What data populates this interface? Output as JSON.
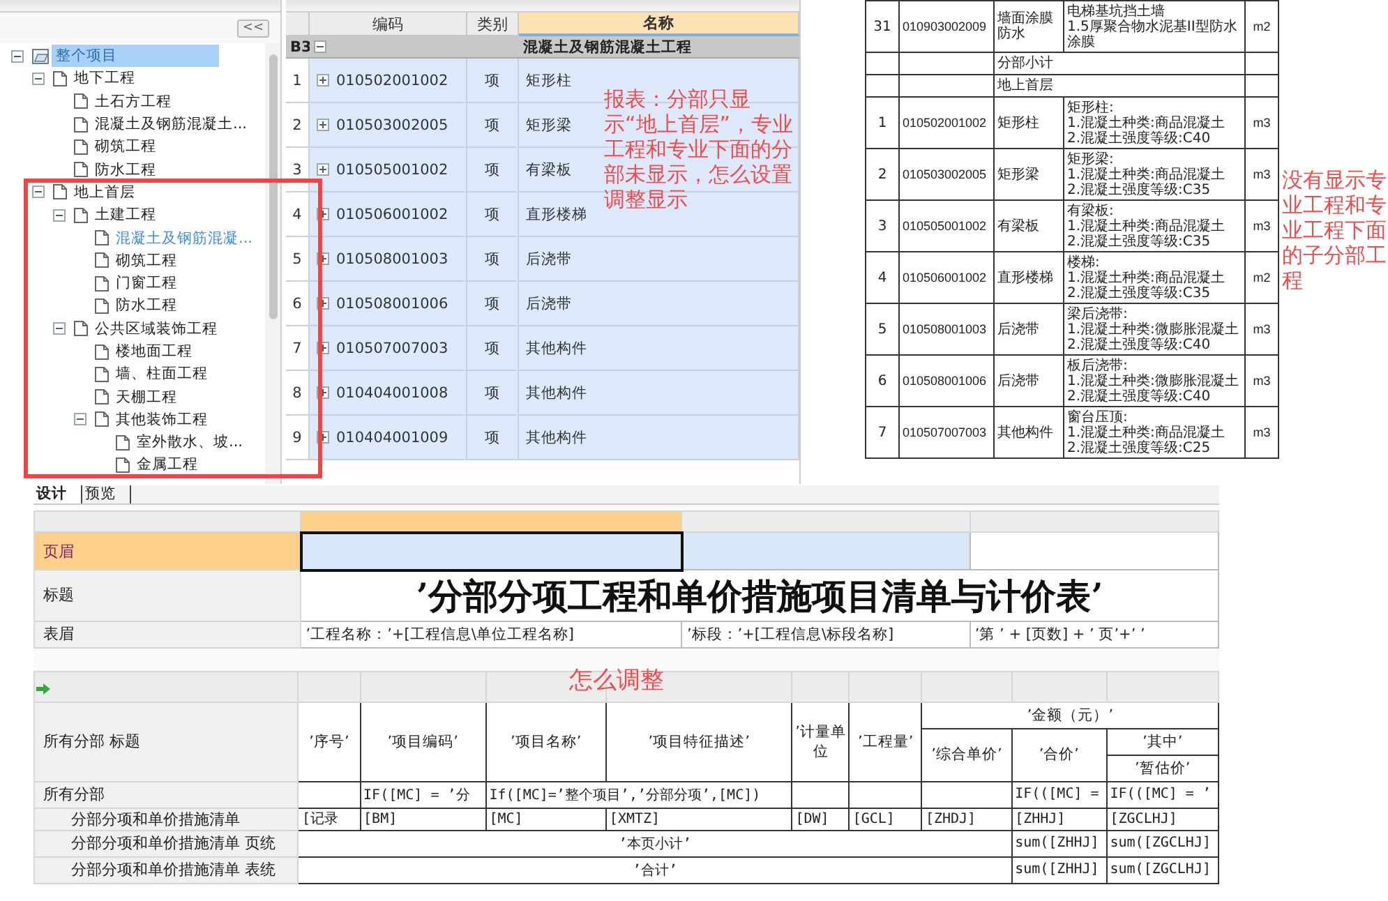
{
  "tree": {
    "collapse_button": "<<",
    "items": [
      {
        "label": "整个项目",
        "kind": "project",
        "selected": true,
        "active": false,
        "expanded": true,
        "children": [
          {
            "label": "地下工程",
            "kind": "part",
            "selected": false,
            "active": false,
            "expanded": true,
            "children": [
              {
                "label": "土石方工程",
                "kind": "part",
                "selected": false,
                "active": false
              },
              {
                "label": "混凝土及钢筋混凝土...",
                "kind": "part",
                "selected": false,
                "active": false
              },
              {
                "label": "砌筑工程",
                "kind": "part",
                "selected": false,
                "active": false
              },
              {
                "label": "防水工程",
                "kind": "part",
                "selected": false,
                "active": false
              }
            ]
          },
          {
            "label": "地上首层",
            "kind": "part",
            "selected": false,
            "active": false,
            "expanded": true,
            "children": [
              {
                "label": "土建工程",
                "kind": "part",
                "selected": false,
                "active": false,
                "expanded": true,
                "children": [
                  {
                    "label": "混凝土及钢筋混凝...",
                    "kind": "part",
                    "selected": false,
                    "active": true
                  },
                  {
                    "label": "砌筑工程",
                    "kind": "part",
                    "selected": false,
                    "active": false
                  },
                  {
                    "label": "门窗工程",
                    "kind": "part",
                    "selected": false,
                    "active": false
                  },
                  {
                    "label": "防水工程",
                    "kind": "part",
                    "selected": false,
                    "active": false
                  }
                ]
              },
              {
                "label": "公共区域装饰工程",
                "kind": "part",
                "selected": false,
                "active": false,
                "expanded": true,
                "children": [
                  {
                    "label": "楼地面工程",
                    "kind": "part",
                    "selected": false,
                    "active": false
                  },
                  {
                    "label": "墙、柱面工程",
                    "kind": "part",
                    "selected": false,
                    "active": false
                  },
                  {
                    "label": "天棚工程",
                    "kind": "part",
                    "selected": false,
                    "active": false
                  },
                  {
                    "label": "其他装饰工程",
                    "kind": "part",
                    "selected": false,
                    "active": false,
                    "expanded": true,
                    "children": [
                      {
                        "label": "室外散水、坡...",
                        "kind": "part",
                        "selected": false,
                        "active": false
                      },
                      {
                        "label": "金属工程",
                        "kind": "part",
                        "selected": false,
                        "active": false
                      }
                    ]
                  }
                ]
              }
            ]
          }
        ]
      }
    ]
  },
  "grid": {
    "columns": [
      {
        "label": "编码",
        "selected": false
      },
      {
        "label": "类别",
        "selected": false
      },
      {
        "label": "名称",
        "selected": true
      }
    ],
    "group": {
      "index": "B3",
      "expanded": true,
      "name": "混凝土及钢筋混凝土工程"
    },
    "rows": [
      {
        "index": "1",
        "code": "010502001002",
        "type": "项",
        "name": "矩形柱",
        "expanded": false
      },
      {
        "index": "2",
        "code": "010503002005",
        "type": "项",
        "name": "矩形梁",
        "expanded": false
      },
      {
        "index": "3",
        "code": "010505001002",
        "type": "项",
        "name": "有梁板",
        "expanded": false
      },
      {
        "index": "4",
        "code": "010506001002",
        "type": "项",
        "name": "直形楼梯",
        "expanded": false
      },
      {
        "index": "5",
        "code": "010508001003",
        "type": "项",
        "name": "后浇带",
        "expanded": false
      },
      {
        "index": "6",
        "code": "010508001006",
        "type": "项",
        "name": "后浇带",
        "expanded": false
      },
      {
        "index": "7",
        "code": "010507007003",
        "type": "项",
        "name": "其他构件",
        "expanded": false
      },
      {
        "index": "8",
        "code": "010404001008",
        "type": "项",
        "name": "其他构件",
        "expanded": false
      },
      {
        "index": "9",
        "code": "010404001009",
        "type": "项",
        "name": "其他构件",
        "expanded": false
      }
    ],
    "note": "报表：分部只显示“地上首层”，专业工程和专业下面的分部未显示，怎么设置调整显示"
  },
  "sheet": {
    "rows": [
      {
        "kind": "item",
        "index": "31",
        "code": "010903002009",
        "name": "墙面涂膜防水",
        "description": "电梯基坑挡土墙\n1.5厚聚合物水泥基II型防水涂膜",
        "unit": "m2"
      },
      {
        "kind": "label",
        "text": "分部小计"
      },
      {
        "kind": "label",
        "text": "地上首层"
      },
      {
        "kind": "item",
        "index": "1",
        "code": "010502001002",
        "name": "矩形柱",
        "description": "矩形柱:\n1.混凝土种类:商品混凝土\n2.混凝土强度等级:C40",
        "unit": "m3"
      },
      {
        "kind": "item",
        "index": "2",
        "code": "010503002005",
        "name": "矩形梁",
        "description": "矩形梁:\n1.混凝土种类:商品混凝土\n2.混凝土强度等级:C35",
        "unit": "m3"
      },
      {
        "kind": "item",
        "index": "3",
        "code": "010505001002",
        "name": "有梁板",
        "description": "有梁板:\n1.混凝土种类:商品混凝土\n2.混凝土强度等级:C35",
        "unit": "m3"
      },
      {
        "kind": "item",
        "index": "4",
        "code": "010506001002",
        "name": "直形楼梯",
        "description": "楼梯:\n1.混凝土种类:商品混凝土\n2.混凝土强度等级:C35",
        "unit": "m2"
      },
      {
        "kind": "item",
        "index": "5",
        "code": "010508001003",
        "name": "后浇带",
        "description": "梁后浇带:\n1.混凝土种类:微膨胀混凝土\n2.混凝土强度等级:C40",
        "unit": "m3"
      },
      {
        "kind": "item",
        "index": "6",
        "code": "010508001006",
        "name": "后浇带",
        "description": "板后浇带:\n1.混凝土种类:微膨胀混凝土\n2.混凝土强度等级:C40",
        "unit": "m3"
      },
      {
        "kind": "item",
        "index": "7",
        "code": "010507007003",
        "name": "其他构件",
        "description": "窗台压顶:\n1.混凝土种类:商品混凝土\n2.混凝土强度等级:C25",
        "unit": "m3"
      }
    ],
    "note": "没有显示专业工程和专业工程下面的子分部工程"
  },
  "designer": {
    "tabs": [
      {
        "label": "设计",
        "selected": true
      },
      {
        "label": "预览",
        "selected": false
      }
    ],
    "bands": [
      {
        "kind": "cells",
        "label": "页眉",
        "selected": true
      },
      {
        "kind": "title",
        "label": "标题",
        "selected": false,
        "title": "’分部分项工程和单价措施项目清单与计价表’"
      },
      {
        "kind": "cells",
        "label": "表眉",
        "selected": false,
        "cells": [
          "’工程名称：’+[工程信息\\单位工程名称]",
          "’标段：’+[工程信息\\标段名称]",
          "’第 ’ + [页数] + ’ 页’+’ ’"
        ]
      }
    ],
    "note": "怎么调整",
    "header_label": "所有分部 标题",
    "header_rows": [
      [
        {
          "text": "’序号’",
          "rowspan": 3
        },
        {
          "text": "’项目编码’",
          "rowspan": 3
        },
        {
          "text": "’项目名称’",
          "rowspan": 3
        },
        {
          "text": "’项目特征描述’",
          "rowspan": 3
        },
        {
          "text": "’计量单位",
          "rowspan": 3
        },
        {
          "text": "’工程量’",
          "rowspan": 3
        },
        {
          "text": "’金额（元）’",
          "colspan": 3
        }
      ],
      [
        {
          "text": "’综合单价’",
          "rowspan": 2
        },
        {
          "text": "’合价’",
          "rowspan": 2
        },
        {
          "text": "’其中’"
        }
      ],
      [
        {
          "text": "’暂估价’"
        }
      ]
    ],
    "rows": [
      {
        "label": "所有分部",
        "indented": false,
        "cells": [
          {},
          {
            "text": "IF([MC] = ’分"
          },
          {
            "text": "If([MC]=’整个项目’,’分部分项’,[MC])",
            "colspan": 2
          },
          {},
          {},
          {},
          {
            "text": "IF(([MC] ="
          },
          {
            "text": "IF(([MC] = ’"
          }
        ]
      },
      {
        "label": "分部分项和单价措施清单",
        "indented": true,
        "cells": [
          {
            "text": "[记录"
          },
          {
            "text": "[BM]"
          },
          {
            "text": "[MC]"
          },
          {
            "text": "[XMTZ]"
          },
          {
            "text": "[DW]"
          },
          {
            "text": "[GCL]"
          },
          {
            "text": "[ZHDJ]"
          },
          {
            "text": "[ZHHJ]"
          },
          {
            "text": "[ZGCLHJ]"
          }
        ]
      },
      {
        "label": "分部分项和单价措施清单 页统",
        "indented": true,
        "cells": [
          {
            "text": "’本页小计’",
            "colspan": 7
          },
          {
            "text": "sum([ZHHJ]"
          },
          {
            "text": "sum([ZGCLHJ]"
          }
        ]
      },
      {
        "label": "分部分项和单价措施清单 表统",
        "indented": true,
        "cells": [
          {
            "text": "’合计’",
            "colspan": 7
          },
          {
            "text": "sum([ZHHJ]"
          },
          {
            "text": "sum([ZGCLHJ]"
          }
        ]
      }
    ]
  }
}
